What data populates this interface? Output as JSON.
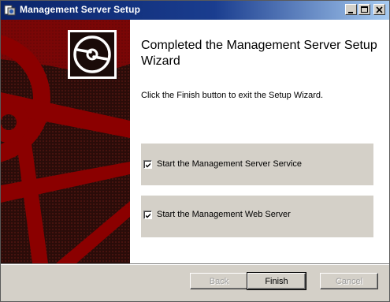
{
  "window": {
    "title": "Management Server Setup",
    "icon": "installer-icon",
    "controls": [
      "minimize",
      "maximize",
      "close"
    ]
  },
  "banner": {
    "logo_icon": "disc-logo-icon",
    "colors": {
      "accent": "#8b0000",
      "dark": "#1a0b09"
    }
  },
  "main": {
    "heading": "Completed the Management Server Setup Wizard",
    "subtext": "Click the Finish button to exit the Setup Wizard.",
    "options": [
      {
        "label": "Start the Management Server Service",
        "checked": true
      },
      {
        "label": "Start the Management Web Server",
        "checked": true
      }
    ]
  },
  "footer": {
    "back_label": "Back",
    "finish_label": "Finish",
    "cancel_label": "Cancel"
  }
}
